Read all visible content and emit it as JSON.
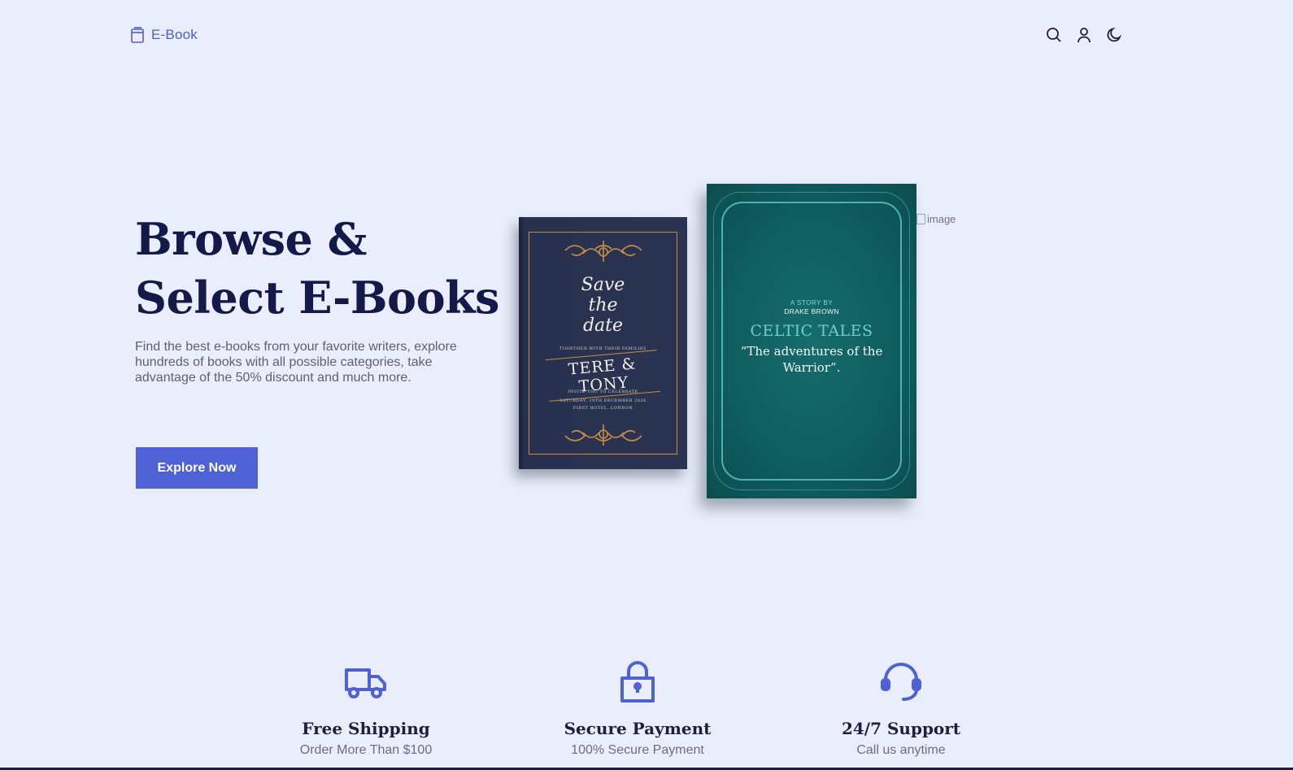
{
  "header": {
    "logo_text": "E-Book",
    "icons": [
      "book-icon",
      "search-icon",
      "user-icon",
      "moon-icon"
    ]
  },
  "hero": {
    "title_line1": "Browse &",
    "title_line2": "Select E-Books",
    "description": "Find the best e-books from your favorite writers, explore hundreds of books with all possible categories, take advantage of the 50% discount and much more.",
    "button_label": "Explore Now",
    "broken_image_alt": "image"
  },
  "books": {
    "book1": {
      "script_line1": "Save",
      "script_line2": "the",
      "script_line3": "date",
      "small_top": "TOGETHER WITH THEIR FAMILIES",
      "names": "TERE & TONY",
      "small_mid": "INVITE YOU TO CELEBRATE",
      "small_date": "SATURDAY, 19TH DECEMBER 2026",
      "small_place": "FIRST HOTEL, LONDON",
      "cover_color": "#2a3452",
      "accent_color": "#c88c43"
    },
    "book2": {
      "story_by": "A STORY BY",
      "author": "DRAKE BROWN",
      "title": "CELTIC TALES",
      "subtitle": "“The adventures of the Warrior”.",
      "cover_color": "#0f5c5d",
      "accent_color": "#4fb2b0"
    }
  },
  "features": [
    {
      "icon": "truck-icon",
      "title": "Free Shipping",
      "desc": "Order More Than $100"
    },
    {
      "icon": "lock-icon",
      "title": "Secure Payment",
      "desc": "100% Secure Payment"
    },
    {
      "icon": "headset-icon",
      "title": "24/7 Support",
      "desc": "Call us anytime"
    }
  ],
  "colors": {
    "background": "#eaeefc",
    "accent": "#4e61d5",
    "heading": "#131a4a"
  }
}
